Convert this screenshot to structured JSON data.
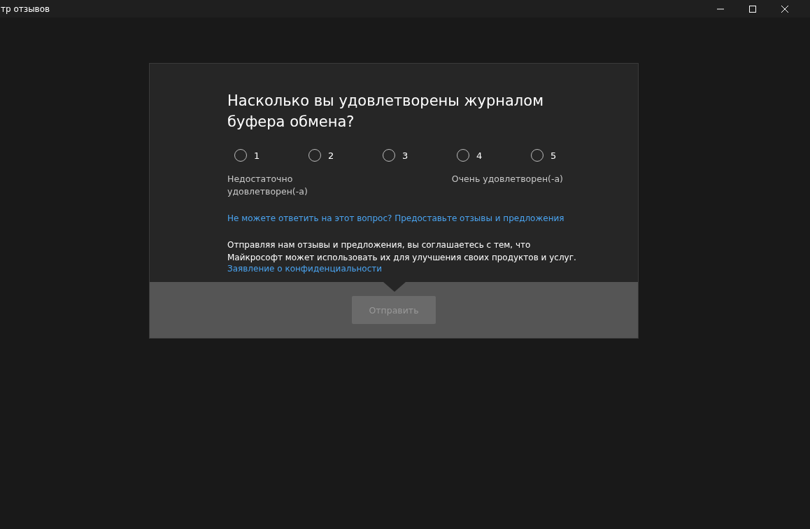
{
  "window": {
    "title": "тр отзывов"
  },
  "question": "Насколько вы удовлетворены журналом буфера обмена?",
  "options": [
    {
      "label": "1",
      "selected": false
    },
    {
      "label": "2",
      "selected": false
    },
    {
      "label": "3",
      "selected": false
    },
    {
      "label": "4",
      "selected": false
    },
    {
      "label": "5",
      "selected": false
    }
  ],
  "scale_low": "Недостаточно удовлетворен(-а)",
  "scale_high": "Очень удовлетворен(-а)",
  "cant_answer_link": "Не можете ответить на этот вопрос? Предоставьте отзывы и предложения",
  "consent": "Отправляя нам отзывы и предложения, вы соглашаетесь с тем, что Майкрософт может использовать их для улучшения своих продуктов и услуг.",
  "privacy_link": "Заявление о конфиденциальности",
  "submit": {
    "label": "Отправить",
    "disabled": true
  }
}
